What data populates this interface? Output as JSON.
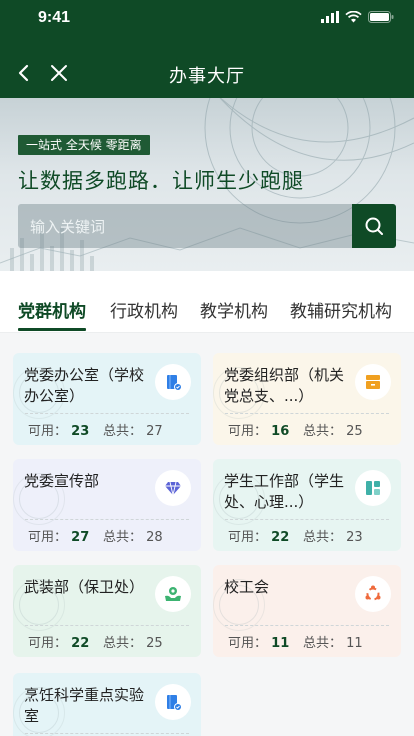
{
  "status_bar": {
    "time": "9:41"
  },
  "nav": {
    "title": "办事大厅"
  },
  "banner": {
    "tagline": "一站式 全天候 零距离",
    "slogan": "让数据多跑路．让师生少跑腿",
    "search_placeholder": "输入关键词"
  },
  "tabs": [
    {
      "label": "党群机构",
      "active": true
    },
    {
      "label": "行政机构",
      "active": false
    },
    {
      "label": "教学机构",
      "active": false
    },
    {
      "label": "教辅研究机构",
      "active": false
    }
  ],
  "labels": {
    "available": "可用：",
    "total": "总共："
  },
  "cards": [
    {
      "name": "党委办公室（学校办公室）",
      "available": "23",
      "total": "27",
      "icon": "book-check-icon"
    },
    {
      "name": "党委组织部（机关党总支、...）",
      "available": "16",
      "total": "25",
      "icon": "drawer-icon"
    },
    {
      "name": "党委宣传部",
      "available": "27",
      "total": "28",
      "icon": "diamond-icon"
    },
    {
      "name": "学生工作部（学生处、心理...）",
      "available": "22",
      "total": "23",
      "icon": "grid-icon"
    },
    {
      "name": "武装部（保卫处）",
      "available": "22",
      "total": "25",
      "icon": "shield-hand-icon"
    },
    {
      "name": "校工会",
      "available": "11",
      "total": "11",
      "icon": "cycle-icon"
    },
    {
      "name": "烹饪科学重点实验室",
      "available": "",
      "total": "",
      "icon": "book-check-icon"
    }
  ],
  "colors": {
    "brand_green": "#0f4a26",
    "icon_blue": "#2f7fe6",
    "icon_orange": "#f0a020",
    "icon_purple": "#5b63d6",
    "icon_teal": "#3fb0a8",
    "icon_green": "#3cb371",
    "icon_red": "#ef6a3c"
  }
}
